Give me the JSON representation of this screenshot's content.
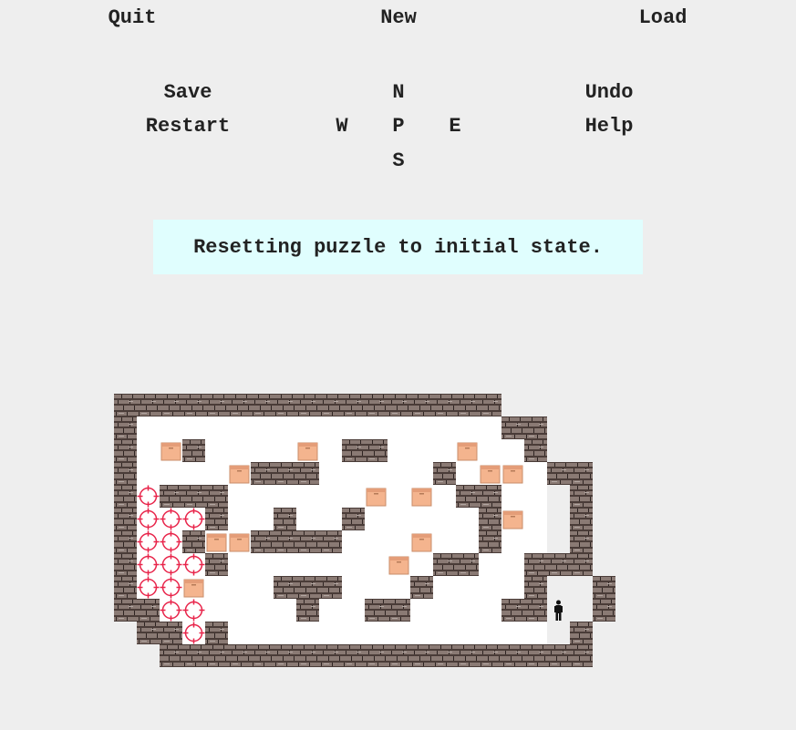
{
  "menu": {
    "quit": "Quit",
    "new": "New",
    "load": "Load",
    "save": "Save",
    "restart": "Restart",
    "undo": "Undo",
    "help": "Help"
  },
  "dpad": {
    "north": "N",
    "west": "W",
    "player": "P",
    "east": "E",
    "south": "S"
  },
  "status": "Resetting puzzle to initial state.",
  "colors": {
    "background": "#eeeeee",
    "status_bg": "#e0fefe",
    "wall": "#7a6a66",
    "crate": "#f4b48e",
    "target": "#e8244a",
    "player": "#111111"
  },
  "level": {
    "cols": 20,
    "rows": 12,
    "map": [
      "#################   ",
      "#                ##  ",
      "# $#    $ ##   $  #  ",
      "#    $###     # $$ ##",
      "#.###      $ $ ##   #",
      "#...#  #  #     #$  #",
      "#..#$$####   $  #   #",
      "#...#       $ ##  ###",
      "#..$   ###   #    #  #",
      "##..    #  ##    ##@ #",
      " ##.#               #",
      "  ###################"
    ]
  }
}
